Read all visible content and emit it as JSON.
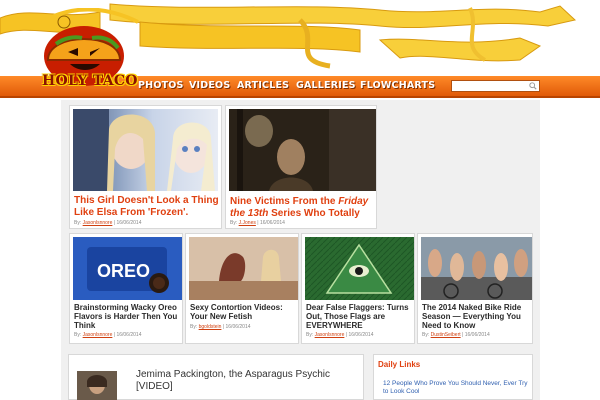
{
  "site": {
    "logo_text": "HOLY TACO"
  },
  "nav": {
    "items": [
      {
        "label": "PHOTOS"
      },
      {
        "label": "VIDEOS"
      },
      {
        "label": "ARTICLES"
      },
      {
        "label": "GALLERIES"
      },
      {
        "label": "FLOWCHARTS"
      }
    ],
    "search_placeholder": ""
  },
  "featured": [
    {
      "title": "This Girl Doesn't Look a Thing Like Elsa From 'Frozen'.",
      "by": "By:",
      "author": "Jasonlsnnore",
      "date": "| 16/06/2014"
    },
    {
      "title_pre": "Nine Victims From the ",
      "title_em": "Friday the 13th",
      "title_post": " Series Who Totally",
      "by": "By:",
      "author": "J.Jones",
      "date": "| 16/06/2014"
    }
  ],
  "posts": [
    {
      "title": "Brainstorming Wacky Oreo Flavors is Harder Then You Think",
      "by": "By:",
      "author": "Jasonlsnnore",
      "date": "| 16/06/2014"
    },
    {
      "title": "Sexy Contortion Videos: Your New Fetish",
      "by": "By:",
      "author": "bgoldstein",
      "date": "| 16/06/2014"
    },
    {
      "title": "Dear False Flaggers: Turns Out, Those Flags are EVERYWHERE",
      "by": "By:",
      "author": "Jasonlsnnore",
      "date": "| 16/06/2014"
    },
    {
      "title": "The 2014 Naked Bike Ride Season — Everything You Need to Know",
      "by": "By:",
      "author": "DustinSeibert",
      "date": "| 16/06/2014"
    }
  ],
  "story": {
    "title": "Jemima Packington, the Asparagus Psychic [VIDEO]"
  },
  "daily_links": {
    "title": "Daily Links",
    "items": [
      {
        "label": "12 People Who Prove You Should Never, Ever Try to Look Cool"
      }
    ]
  },
  "colors": {
    "nav_orange": "#ff7a1a",
    "title_orange": "#e04010",
    "link_blue": "#3060b0",
    "ribbon_yellow": "#f6c324"
  }
}
